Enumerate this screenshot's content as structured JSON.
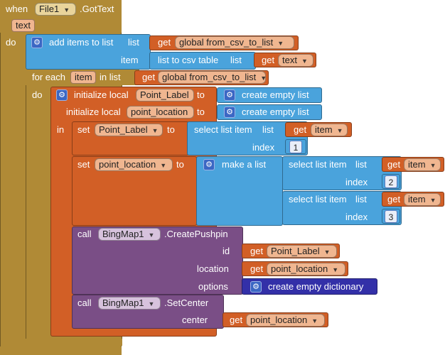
{
  "event": {
    "when_label": "when",
    "component": "File1",
    "event_name": ".GotText",
    "param": "text",
    "do_label": "do"
  },
  "add_items": {
    "label": "add items to list",
    "list_label": "list",
    "list_get": "get",
    "list_var": "global from_csv_to_list",
    "item_label": "item",
    "csv_label": "list to csv table",
    "csv_list_label": "list",
    "csv_get": "get",
    "csv_var": "text"
  },
  "for_each": {
    "label": "for each",
    "var": "item",
    "in_list_label": "in list",
    "get": "get",
    "list_var": "global from_csv_to_list",
    "do_label": "do"
  },
  "init_local": {
    "label1": "initialize local",
    "var1": "Point_Label",
    "to1": "to",
    "value1": "create empty list",
    "label2": "initialize local",
    "var2": "point_location",
    "to2": "to",
    "value2": "create empty list",
    "in_label": "in"
  },
  "set1": {
    "set_label": "set",
    "var": "Point_Label",
    "to_label": "to",
    "select_label": "select list item",
    "list_label": "list",
    "get": "get",
    "list_var": "item",
    "index_label": "index",
    "index_value": "1"
  },
  "set2": {
    "set_label": "set",
    "var": "point_location",
    "to_label": "to",
    "make_list": "make a list",
    "select1": "select list item",
    "list1": "list",
    "get1": "get",
    "var1": "item",
    "index1_label": "index",
    "index1_value": "2",
    "select2": "select list item",
    "list2": "list",
    "get2": "get",
    "var2": "item",
    "index2_label": "index",
    "index2_value": "3"
  },
  "pushpin": {
    "call_label": "call",
    "component": "BingMap1",
    "method": ".CreatePushpin",
    "id_label": "id",
    "id_get": "get",
    "id_var": "Point_Label",
    "location_label": "location",
    "location_get": "get",
    "location_var": "point_location",
    "options_label": "options",
    "options_value": "create empty dictionary"
  },
  "set_center": {
    "call_label": "call",
    "component": "BingMap1",
    "method": ".SetCenter",
    "center_label": "center",
    "center_get": "get",
    "center_var": "point_location"
  },
  "colors": {
    "event": "#b08a36",
    "list": "#4aa3dc",
    "variable": "#d25f26",
    "component": "#7a4e86",
    "dictionary": "#3330a8"
  },
  "icons": [
    "gear-icon",
    "dropdown-arrow-icon"
  ]
}
